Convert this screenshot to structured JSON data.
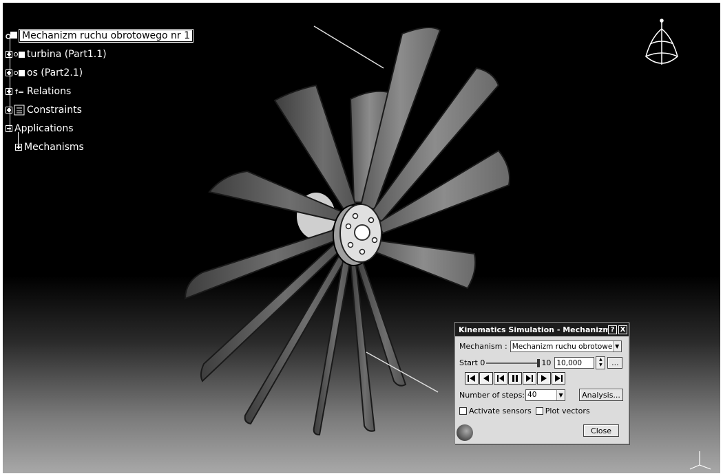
{
  "tree": {
    "root": "Mechanizm ruchu obrotowego nr 1",
    "items": [
      {
        "label": "turbina (Part1.1)",
        "icon": "part-icon"
      },
      {
        "label": "os (Part2.1)",
        "icon": "part-icon"
      },
      {
        "label": "Relations",
        "icon": "relations-icon"
      },
      {
        "label": "Constraints",
        "icon": "constraints-icon"
      },
      {
        "label": "Applications",
        "icon": "none"
      },
      {
        "label": "Mechanisms",
        "icon": "none"
      }
    ]
  },
  "dialog": {
    "title": "Kinematics Simulation - Mechanizm ...",
    "help_btn": "?",
    "close_btn": "X",
    "mechanism_label": "Mechanism :",
    "mechanism_value": "Mechanizm ruchu obrotowego",
    "start_label": "Start 0",
    "end_label": "10",
    "time_value": "10,000",
    "more_btn": "...",
    "steps_label": "Number of steps:",
    "steps_value": "40",
    "analysis_btn": "Analysis...",
    "activate_sensors": "Activate sensors",
    "plot_vectors": "Plot vectors",
    "close_label": "Close"
  },
  "colors": {
    "background_top": "#000000",
    "background_bottom": "#a8a8a8",
    "blade": "#7a7a7a"
  }
}
